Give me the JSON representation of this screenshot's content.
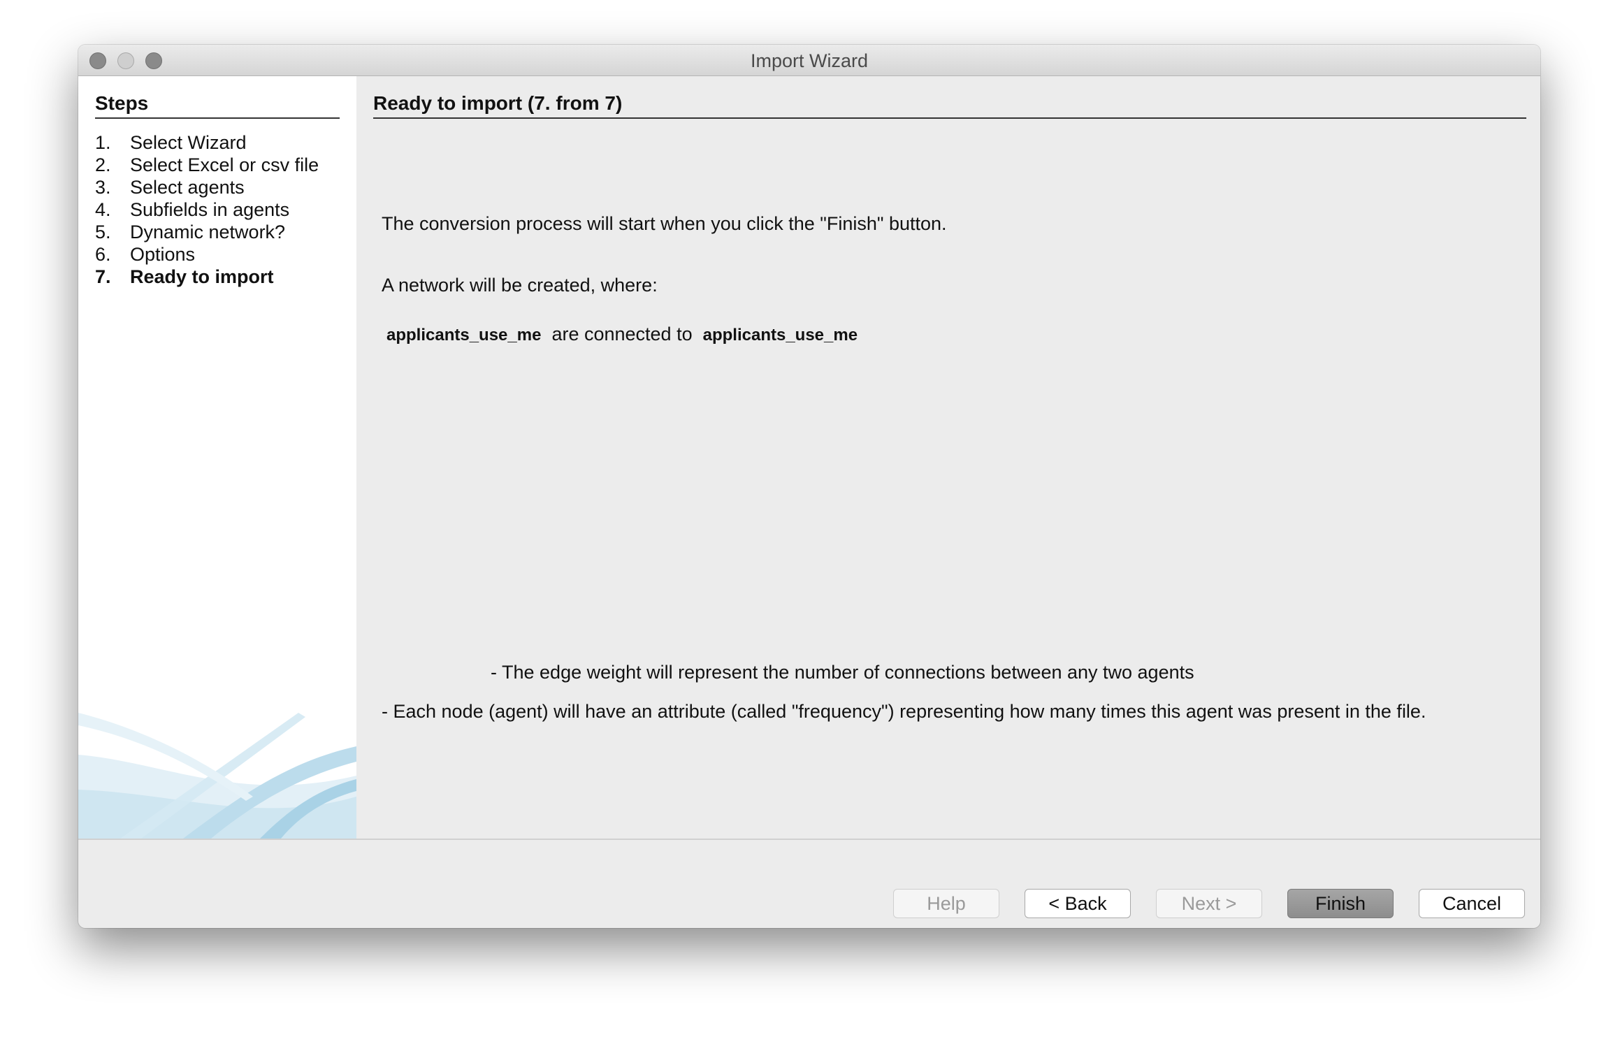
{
  "window": {
    "title": "Import Wizard"
  },
  "sidebar": {
    "title": "Steps",
    "steps": [
      {
        "num": "1.",
        "label": "Select Wizard"
      },
      {
        "num": "2.",
        "label": "Select Excel or csv file"
      },
      {
        "num": "3.",
        "label": "Select agents"
      },
      {
        "num": "4.",
        "label": "Subfields in agents"
      },
      {
        "num": "5.",
        "label": "Dynamic network?"
      },
      {
        "num": "6.",
        "label": "Options"
      },
      {
        "num": "7.",
        "label": "Ready to import"
      }
    ],
    "current_step": 7
  },
  "main": {
    "title": "Ready to import (7. from 7)",
    "intro": "The conversion process will start when you click the \"Finish\" button.",
    "network_line": "A network will be created, where:",
    "source_agent": "applicants_use_me",
    "connector": "are connected to",
    "target_agent": "applicants_use_me",
    "edge_weight_note": "- The edge weight will represent the number of connections between any two agents",
    "node_attr_note": "- Each node (agent) will have an attribute (called \"frequency\") representing how many times this agent was present in the file."
  },
  "buttons": {
    "help": "Help",
    "back": "< Back",
    "next": "Next >",
    "finish": "Finish",
    "cancel": "Cancel"
  }
}
